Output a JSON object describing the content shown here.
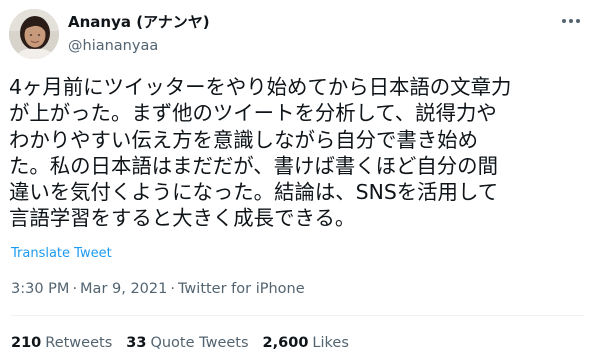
{
  "author": {
    "display_name": "Ananya (アナンヤ)",
    "handle": "@hiananyaa"
  },
  "tweet": {
    "lines": [
      "4ヶ月前にツイッターをやり始めてから日本語の文章力",
      "が上がった。まず他のツイートを分析して、説得力や",
      "わかりやすい伝え方を意識しながら自分で書き始め",
      "た。私の日本語はまだだが、書けば書くほど自分の間",
      "違いを気付くようになった。結論は、SNSを活用して",
      "言語学習をすると大きく成長できる。"
    ],
    "translate_label": "Translate Tweet"
  },
  "meta": {
    "time": "3:30 PM",
    "separator": "·",
    "date": "Mar 9, 2021",
    "source": "Twitter for iPhone"
  },
  "stats": {
    "retweets_count": "210",
    "retweets_label": "Retweets",
    "quote_tweets_count": "33",
    "quote_tweets_label": "Quote Tweets",
    "likes_count": "2,600",
    "likes_label": "Likes"
  },
  "icons": {
    "more": "more-horizontal-icon",
    "avatar": "profile-photo"
  },
  "colors": {
    "link": "#1d9bf0",
    "secondary_text": "#536471",
    "primary_text": "#0f1419",
    "divider": "#eff3f4"
  }
}
